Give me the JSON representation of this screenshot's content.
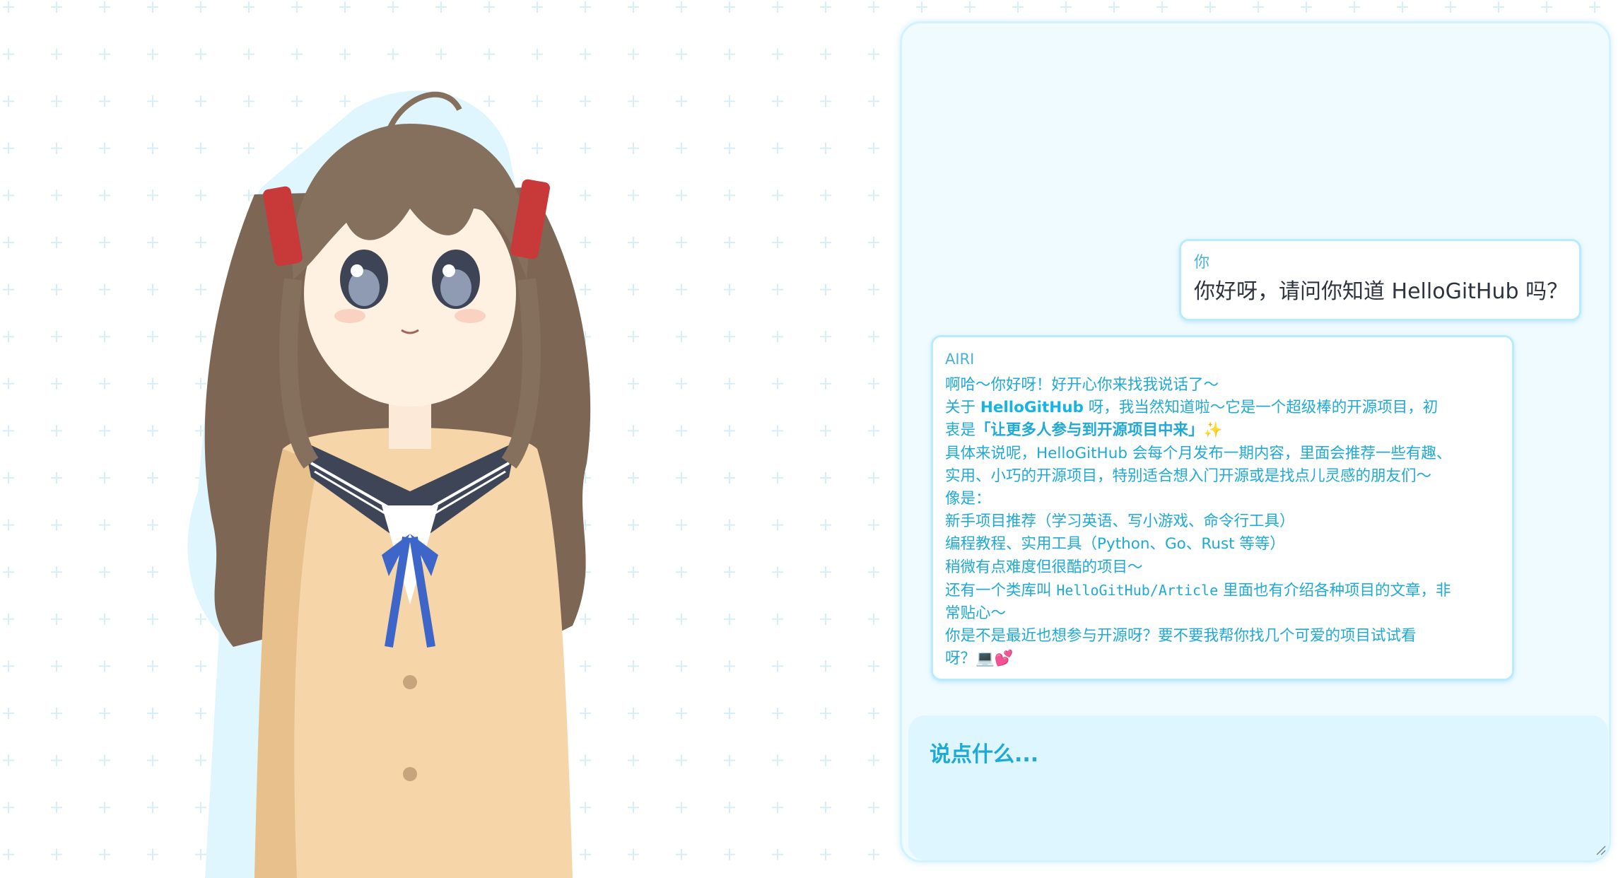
{
  "chat": {
    "user_message": {
      "name": "你",
      "text": "你好呀，请问你知道 HelloGitHub 吗？"
    },
    "ai_message": {
      "name": "AIRI",
      "line1": "啊哈～你好呀！好开心你来找我说话了～",
      "line2_a": "关于 ",
      "line2_brand": "HelloGitHub",
      "line2_b": " 呀，我当然知道啦～它是一个超级棒的开源项目，初",
      "line3_a": "衷是",
      "line3_bold": "「让更多人参与到开源项目中来」",
      "line3_emoji": "✨",
      "line4": "具体来说呢，HelloGitHub 会每个月发布一期内容，里面会推荐一些有趣、",
      "line5": "实用、小巧的开源项目，特别适合想入门开源或是找点儿灵感的朋友们～",
      "line6": "像是：",
      "line7": "新手项目推荐（学习英语、写小游戏、命令行工具）",
      "line8": "编程教程、实用工具（Python、Go、Rust 等等）",
      "line9": "稍微有点难度但很酷的项目～",
      "line10_a": "还有一个类库叫 ",
      "line10_mono": "HelloGitHub/Article",
      "line10_b": " 里面也有介绍各种项目的文章，非",
      "line11": "常贴心～",
      "line12": "你是不是最近也想参与开源呀？要不要我帮你找几个可爱的项目试试看",
      "line13_a": "呀？",
      "line13_emoji": "💻💕"
    }
  },
  "input": {
    "placeholder": "说点什么..."
  },
  "colors": {
    "accent": "#1fa9d6",
    "panel_bg": "#effbff",
    "bubble_border": "#b9ebfc",
    "input_bg": "#ddf6ff"
  },
  "icons": {
    "resize": "resize-grip-icon"
  }
}
